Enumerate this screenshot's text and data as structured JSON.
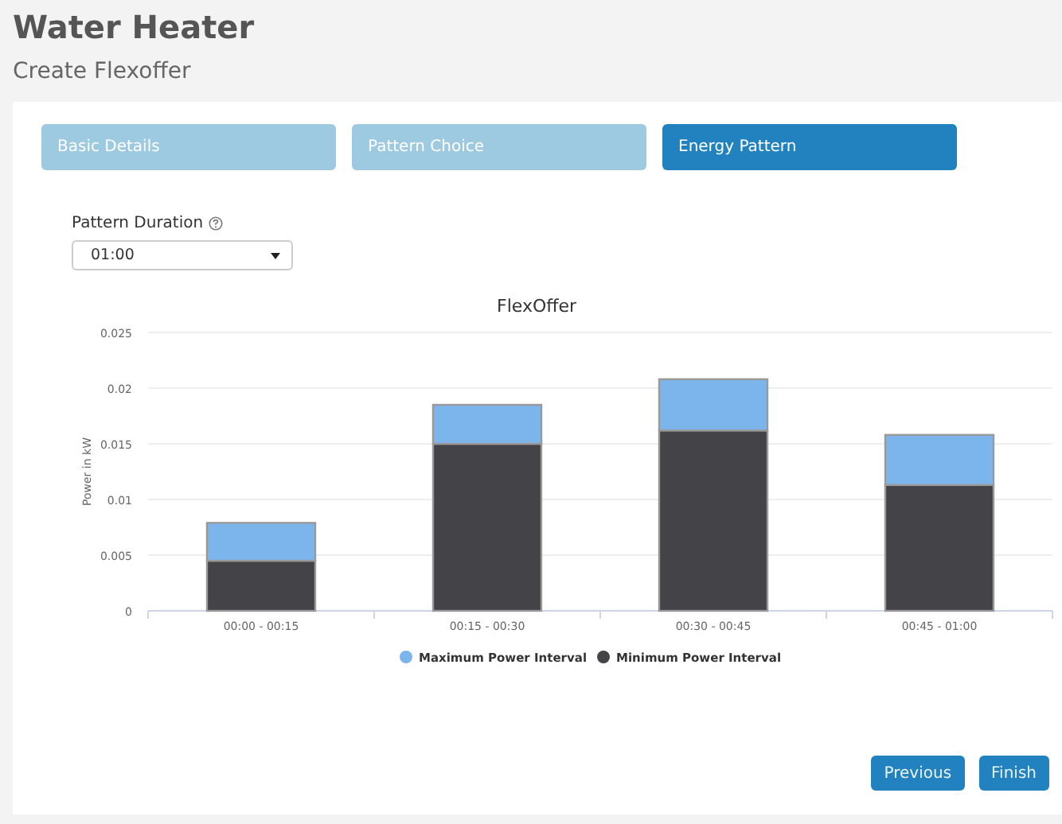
{
  "header": {
    "title": "Water Heater",
    "subtitle": "Create Flexoffer"
  },
  "steps": [
    {
      "label": "Basic Details",
      "selected": false
    },
    {
      "label": "Pattern Choice",
      "selected": false
    },
    {
      "label": "Energy Pattern",
      "selected": true
    }
  ],
  "pattern_duration": {
    "label": "Pattern Duration",
    "value": "01:00"
  },
  "chart": {
    "chart_data": {
      "type": "bar",
      "title": "FlexOffer",
      "ylabel": "Power in kW",
      "stacked": true,
      "categories": [
        "00:00 - 00:15",
        "00:15 - 00:30",
        "00:30 - 00:45",
        "00:45 - 01:00"
      ],
      "series": [
        {
          "name": "Minimum Power Interval",
          "color": "#434348",
          "values": [
            0.0045,
            0.015,
            0.0162,
            0.0113
          ]
        },
        {
          "name": "Maximum Power Interval",
          "color": "#7cb5ec",
          "values": [
            0.0034,
            0.0035,
            0.0046,
            0.0045
          ]
        }
      ],
      "ylim": [
        0,
        0.025
      ],
      "yticks": [
        {
          "value": 0,
          "label": "0"
        },
        {
          "value": 0.005,
          "label": "0.005"
        },
        {
          "value": 0.01,
          "label": "0.01"
        },
        {
          "value": 0.015,
          "label": "0.015"
        },
        {
          "value": 0.02,
          "label": "0.02"
        },
        {
          "value": 0.025,
          "label": "0.025"
        }
      ],
      "grid": true,
      "legend": "bottom"
    }
  },
  "buttons": [
    "Previous",
    "Finish"
  ]
}
